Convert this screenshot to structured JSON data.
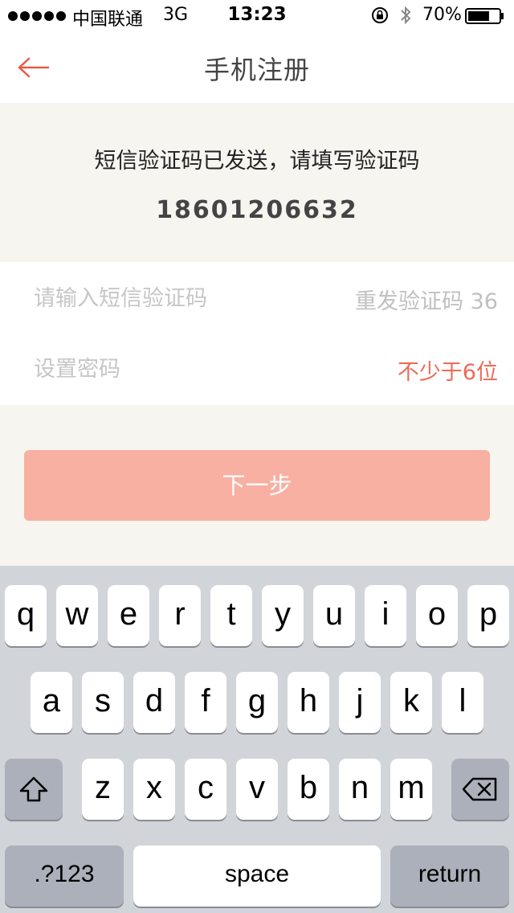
{
  "status_bar": {
    "carrier": "中国联通",
    "network": "3G",
    "time": "13:23",
    "battery": "70%",
    "battery_level": 0.7
  },
  "nav": {
    "title": "手机注册",
    "back_icon": "arrow-left-icon",
    "accent_color": "#e85a47"
  },
  "info": {
    "message": "短信验证码已发送，请填写验证码",
    "phone": "18601206632"
  },
  "form": {
    "code_placeholder": "请输入短信验证码",
    "code_value": "",
    "resend_label": "重发验证码 36",
    "password_placeholder": "设置密码",
    "password_value": "",
    "password_hint": "不少于6位"
  },
  "next_button": {
    "label": "下一步",
    "color": "#f8b0a2"
  },
  "keyboard": {
    "row1": [
      "q",
      "w",
      "e",
      "r",
      "t",
      "y",
      "u",
      "i",
      "o",
      "p"
    ],
    "row2": [
      "a",
      "s",
      "d",
      "f",
      "g",
      "h",
      "j",
      "k",
      "l"
    ],
    "row3": [
      "z",
      "x",
      "c",
      "v",
      "b",
      "n",
      "m"
    ],
    "numbers_label": ".?123",
    "space_label": "space",
    "return_label": "return",
    "shift_icon": "shift-icon",
    "delete_icon": "backspace-icon"
  }
}
